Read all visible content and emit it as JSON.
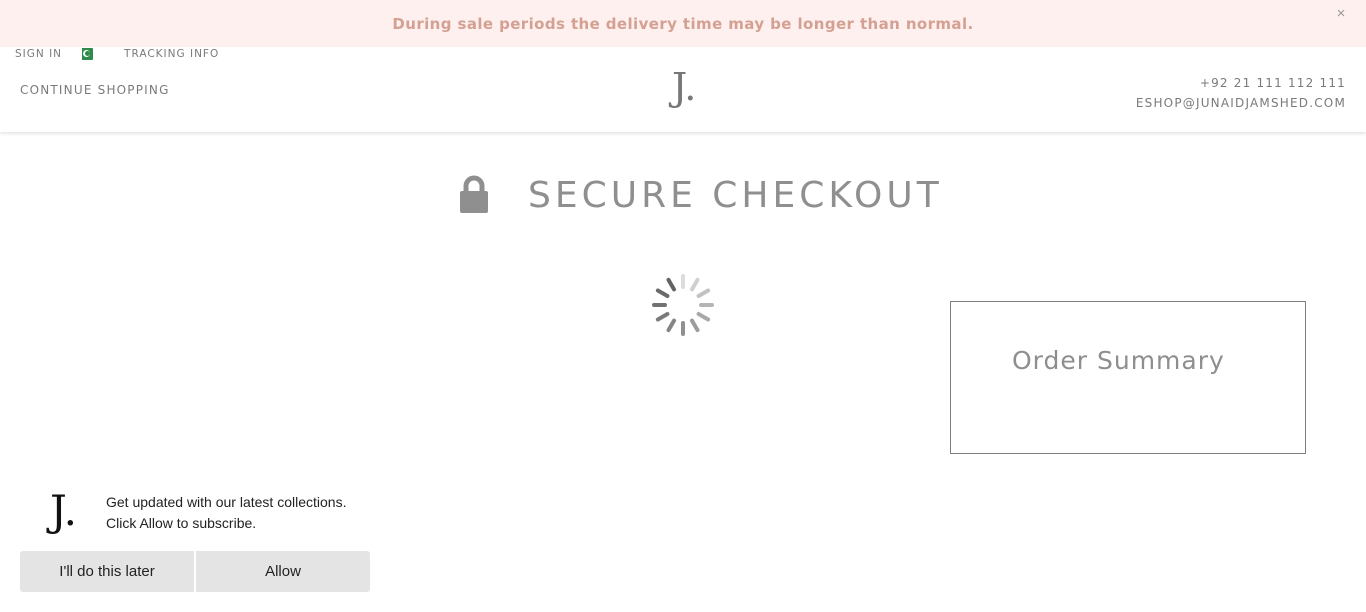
{
  "announcement": {
    "text": "During sale periods the delivery time may be longer than normal.",
    "close_glyph": "×"
  },
  "header": {
    "sign_in": "SIGN IN",
    "country_flag_icon": "pakistan-flag-icon",
    "tracking_info": "TRACKING INFO",
    "continue_shopping": "CONTINUE SHOPPING",
    "logo": "J.",
    "phone": "+92 21 111 112 111",
    "email": "ESHOP@JUNAIDJAMSHED.COM"
  },
  "checkout": {
    "icon": "lock-icon",
    "title": "SECURE CHECKOUT",
    "loading_icon": "spinner-icon"
  },
  "order_summary": {
    "title": "Order Summary"
  },
  "push_prompt": {
    "logo": "J.",
    "line1": "Get updated with our latest collections.",
    "line2": "Click Allow to subscribe.",
    "later_label": "I'll do this later",
    "allow_label": "Allow"
  },
  "colors": {
    "announcement_bg": "#fdf0ef",
    "announcement_text": "#d4a092",
    "text_grey": "#7a7a7a",
    "title_grey": "#8f8f8f",
    "button_bg": "#e4e4e4"
  }
}
